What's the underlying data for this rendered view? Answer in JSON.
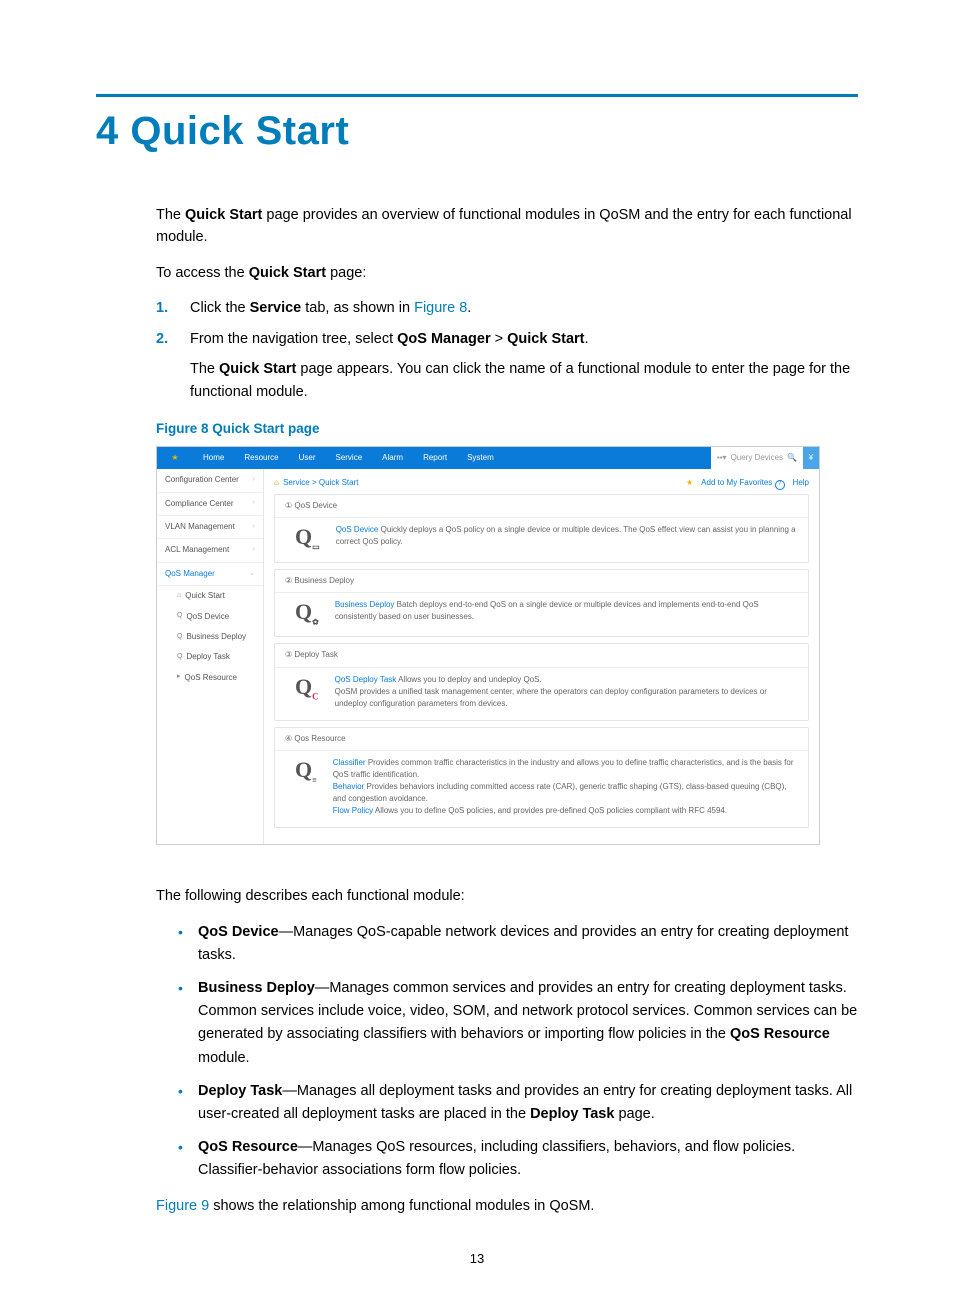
{
  "heading": "4 Quick Start",
  "intro_pre": "The ",
  "intro_bold1": "Quick Start",
  "intro_post1": " page provides an overview of functional modules in QoSM and the entry for each functional module.",
  "access_pre": "To access the ",
  "access_bold": "Quick Start",
  "access_post": " page:",
  "steps": [
    {
      "num": "1.",
      "pre": "Click the ",
      "b": "Service",
      "mid": " tab, as shown in ",
      "link": "Figure 8",
      "post": "."
    },
    {
      "num": "2.",
      "pre": "From the navigation tree, select ",
      "b1": "QoS Manager",
      "gt": " > ",
      "b2": "Quick Start",
      "post": ".",
      "sub_pre": "The ",
      "sub_b": "Quick Start",
      "sub_post": " page appears. You can click the name of a functional module to enter the page for the functional module."
    }
  ],
  "fig8_caption": "Figure 8 Quick Start page",
  "ss": {
    "tabs": [
      "Home",
      "Resource",
      "User",
      "Service",
      "Alarm",
      "Report",
      "System"
    ],
    "search_placeholder": "Query Devices",
    "side": {
      "rows": [
        "Configuration Center",
        "Compliance Center",
        "VLAN Management",
        "ACL Management"
      ],
      "active": "QoS Manager",
      "subs": [
        "Quick Start",
        "QoS Device",
        "Business Deploy",
        "Deploy Task",
        "QoS Resource"
      ]
    },
    "crumbs": {
      "link1": "Service",
      "sep": " > ",
      "cur": "Quick Start",
      "addfav": "Add to My Favorites",
      "help": "Help"
    },
    "cards": [
      {
        "head": "① QoS Device",
        "link": "QoS Device",
        "text": " Quickly deploys a QoS policy on a single device or multiple devices. The QoS effect view can assist you in planning a correct QoS policy."
      },
      {
        "head": "② Business Deploy",
        "link": "Business Deploy",
        "text": " Batch deploys end-to-end QoS on a single device or multiple devices and implements end-to-end QoS consistently based on user businesses."
      },
      {
        "head": "③ Deploy Task",
        "link": "QoS Deploy Task",
        "text": " Allows you to deploy and undeploy QoS.",
        "extra": "QoSM provides a unified task management center, where the operators can deploy configuration parameters to devices or undeploy configuration parameters from devices."
      },
      {
        "head": "④ Qos Resource",
        "multi": [
          {
            "link": "Classifier",
            "text": " Provides common traffic characteristics in the industry and allows you to define traffic characteristics, and is the basis for QoS traffic identification."
          },
          {
            "link": "Behavior",
            "text": " Provides behaviors including committed access rate (CAR), generic traffic shaping (GTS), class-based queuing (CBQ), and congestion avoidance."
          },
          {
            "link": "Flow Policy",
            "text": " Allows you to define QoS policies, and provides pre-defined QoS policies compliant with RFC 4594."
          }
        ]
      }
    ]
  },
  "describe_intro": "The following describes each functional module:",
  "desc_items": [
    {
      "b": "QoS Device",
      "text": "—Manages QoS-capable network devices and provides an entry for creating deployment tasks."
    },
    {
      "b": "Business Deploy",
      "text": "—Manages common services and provides an entry for creating deployment tasks. Common services include voice, video, SOM, and network protocol services. Common services can be generated by associating classifiers with behaviors or importing flow policies in the ",
      "b2": "QoS Resource",
      "text2": " module."
    },
    {
      "b": "Deploy Task",
      "text": "—Manages all deployment tasks and provides an entry for creating deployment tasks. All user-created all deployment tasks are placed in the ",
      "b2": "Deploy Task",
      "text2": " page."
    },
    {
      "b": "QoS Resource",
      "text": "—Manages QoS resources, including classifiers, behaviors, and flow policies. Classifier-behavior associations form flow policies."
    }
  ],
  "fig9_ref": "Figure 9",
  "fig9_post": " shows the relationship among functional modules in QoSM.",
  "pagenum": "13"
}
